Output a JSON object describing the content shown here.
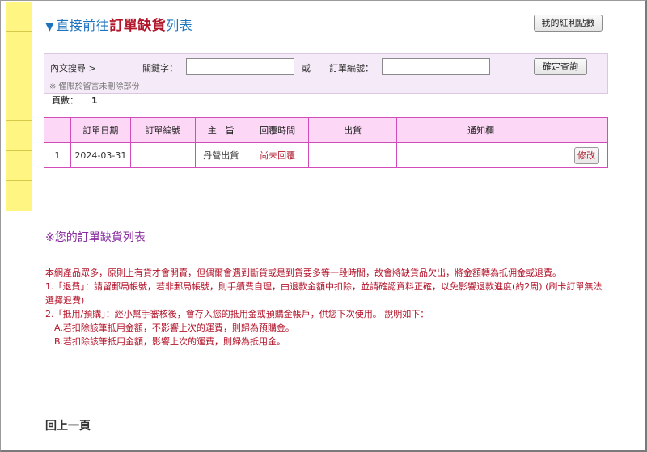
{
  "header": {
    "title_prefix": "直接前往",
    "title_highlight": "訂單缺貨",
    "title_suffix": "列表",
    "bonus_button": "我的紅利點數"
  },
  "search": {
    "section_label": "內文搜尋 >",
    "keyword_label": "關鍵字：",
    "keyword_value": "",
    "or_label": "或",
    "order_no_label": "訂單編號：",
    "order_no_value": "",
    "submit_button": "確定查詢",
    "note": "※ 僅限於留言未刪除部份"
  },
  "pagination": {
    "label": "頁數：",
    "current": "1"
  },
  "table": {
    "headers": [
      "",
      "訂單日期",
      "訂單編號",
      "主　旨",
      "回覆時間",
      "出貨",
      "通知欄",
      ""
    ],
    "rows": [
      {
        "index": "1",
        "date": "2024-03-31",
        "order_no": "",
        "subject": "丹營出貨",
        "reply": "尚未回覆",
        "shipping": "",
        "notice": "",
        "action": "修改"
      }
    ]
  },
  "info": {
    "title": "※您的訂單缺貨列表",
    "line1": "本網產品眾多，原則上有貨才會開賣，但偶爾會遇到斷貨或是到貨要多等一段時間，故會將缺貨品欠出，將金額轉為抵佣金或退費。",
    "line2": "1.「退費」：請留郵局帳號，若非郵局帳號，則手續費自理，由退款金額中扣除，並請確認資料正確，以免影響退款進度(約2周) (刷卡訂單無法選擇退費)",
    "line3": "2.「抵用/預購」：經小幫手審核後，會存入您的抵用金或預購金帳戶，供您下次使用。 說明如下：",
    "line4": "A.若扣除該筆抵用金額，不影響上次的運費，則歸為預購金。",
    "line5": "B.若扣除該筆抵用金額，影響上次的運費，則歸為抵用金。"
  },
  "footer": {
    "back_link": "回上一頁"
  }
}
